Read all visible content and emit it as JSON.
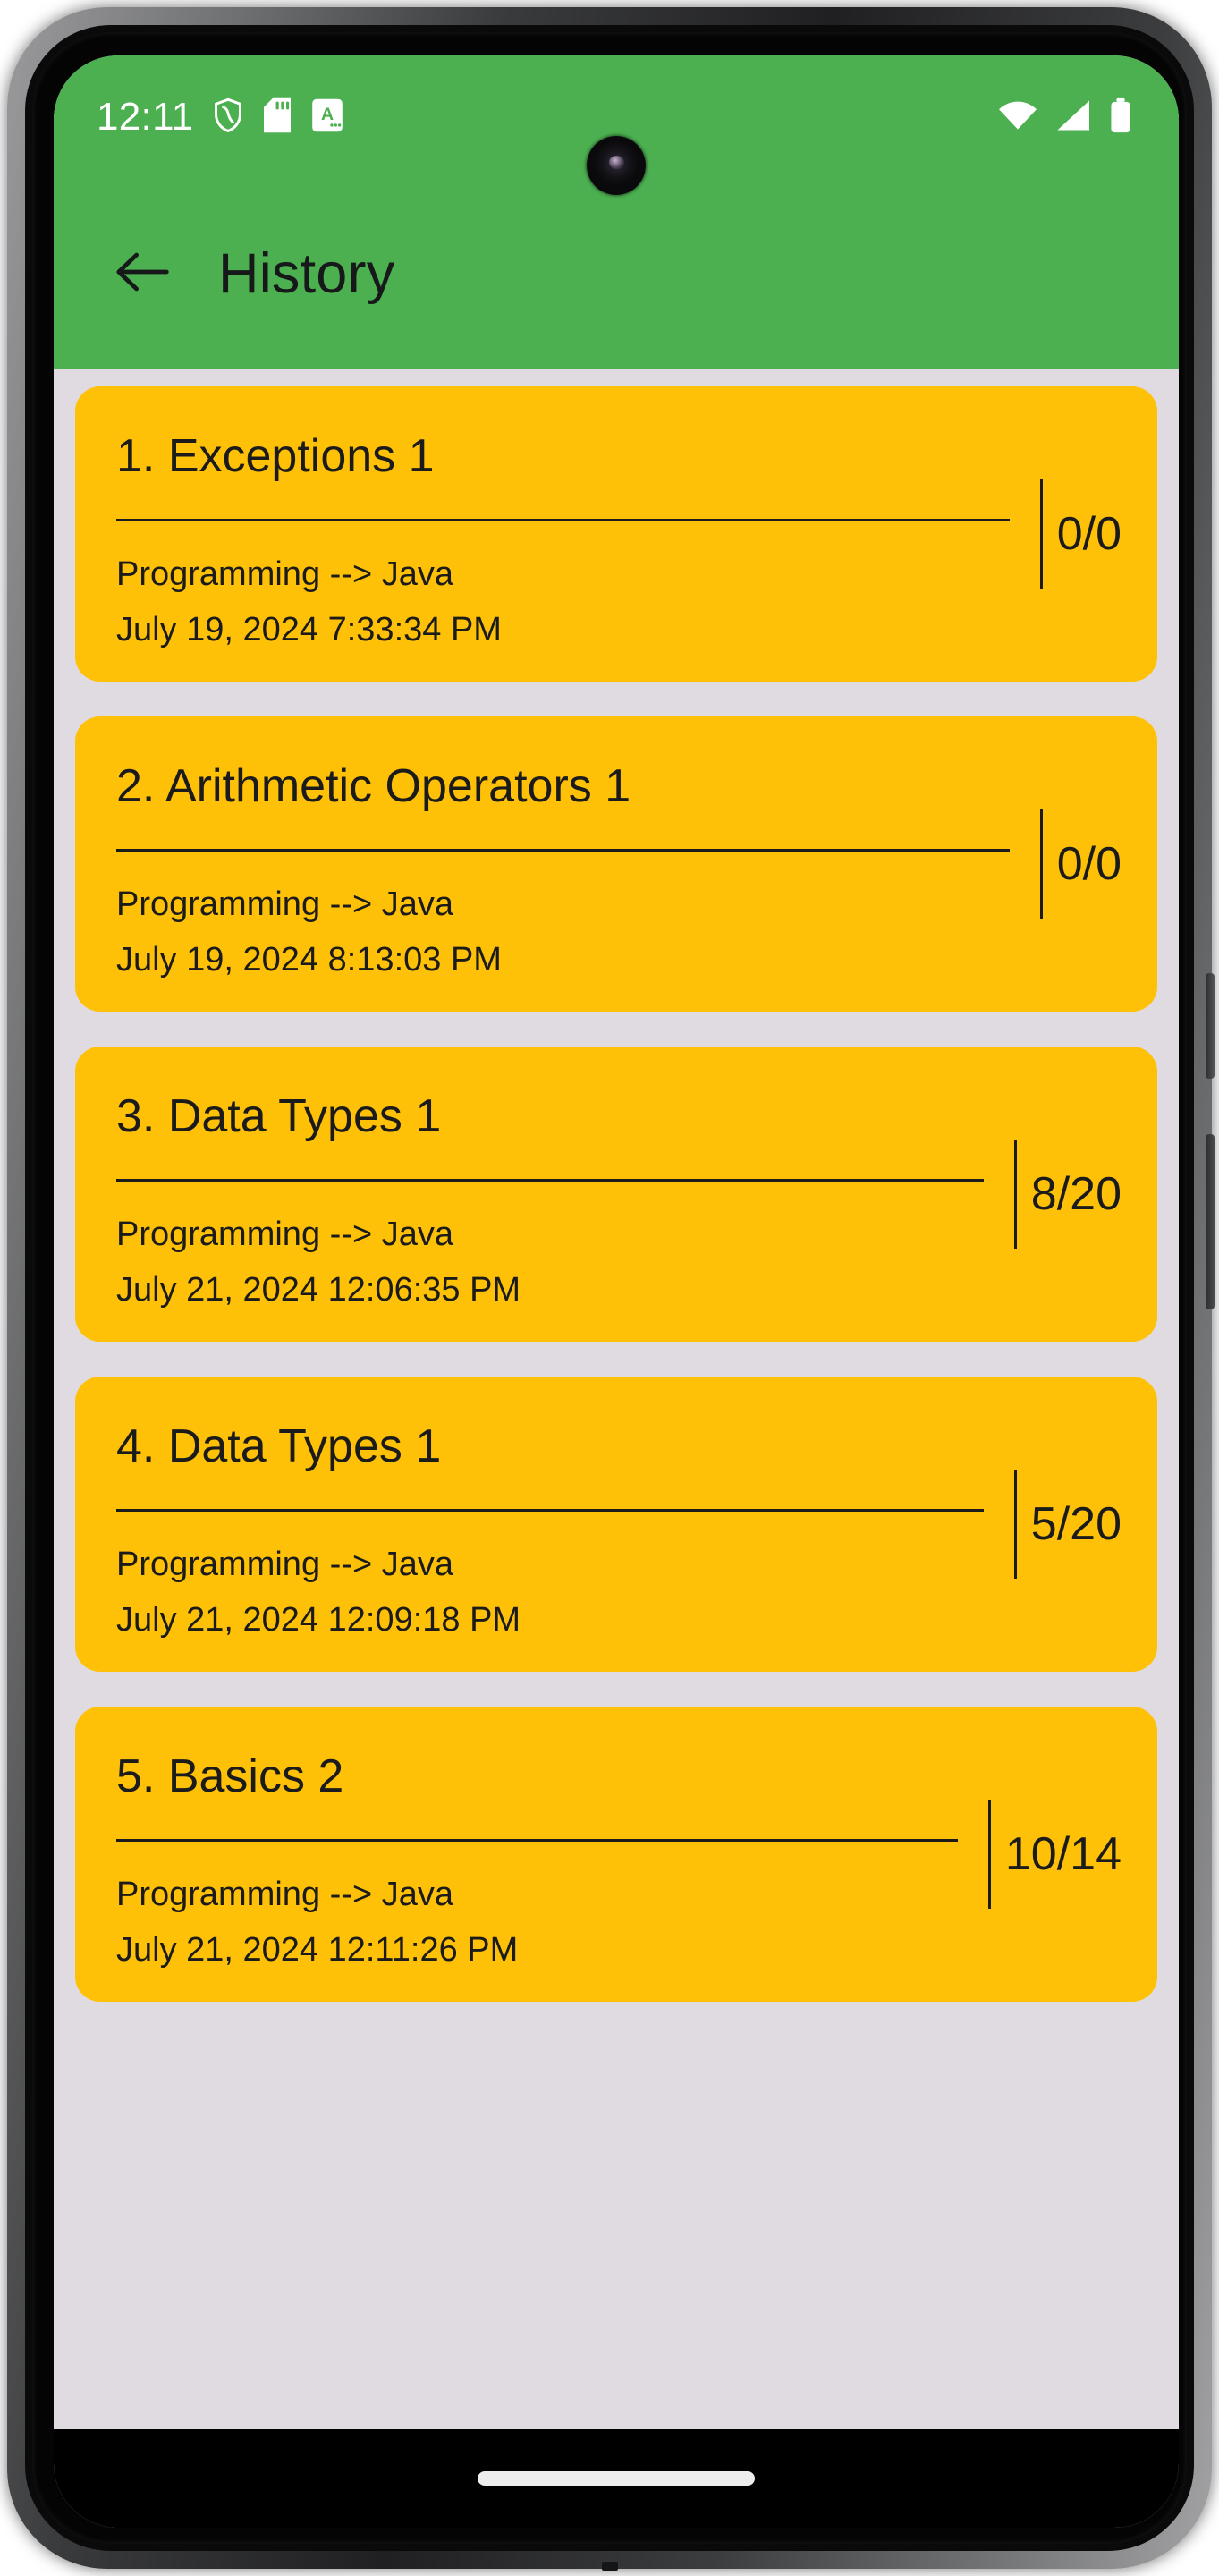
{
  "status_bar": {
    "clock": "12:11",
    "left_icons": [
      "shield-icon",
      "sd-card-icon",
      "keyboard-language-a-icon"
    ],
    "right_icons": [
      "wifi-icon",
      "cellular-signal-icon",
      "battery-icon"
    ],
    "background_color": "#4caf50",
    "foreground_color": "#ffffff"
  },
  "app_bar": {
    "title": "History",
    "back_icon": "arrow-left-icon",
    "background_color": "#4caf50",
    "title_color": "#16181a"
  },
  "content": {
    "background_color": "#dfdbe1",
    "card_color": "#ffc107",
    "card_text_color": "#1b1b1b",
    "cards": [
      {
        "title": "1. Exceptions 1",
        "subtitle": "Programming --> Java",
        "timestamp": "July 19, 2024 7:33:34 PM",
        "score": "0/0"
      },
      {
        "title": "2. Arithmetic Operators 1",
        "subtitle": "Programming --> Java",
        "timestamp": "July 19, 2024 8:13:03 PM",
        "score": "0/0"
      },
      {
        "title": "3. Data Types 1",
        "subtitle": "Programming --> Java",
        "timestamp": "July 21, 2024 12:06:35 PM",
        "score": "8/20"
      },
      {
        "title": "4. Data Types 1",
        "subtitle": "Programming --> Java",
        "timestamp": "July 21, 2024 12:09:18 PM",
        "score": "5/20"
      },
      {
        "title": "5. Basics 2",
        "subtitle": "Programming --> Java",
        "timestamp": "July 21, 2024 12:11:26 PM",
        "score": "10/14"
      }
    ]
  },
  "nav_bar": {
    "gesture_pill": "home-gesture-pill",
    "background_color": "#000000"
  }
}
